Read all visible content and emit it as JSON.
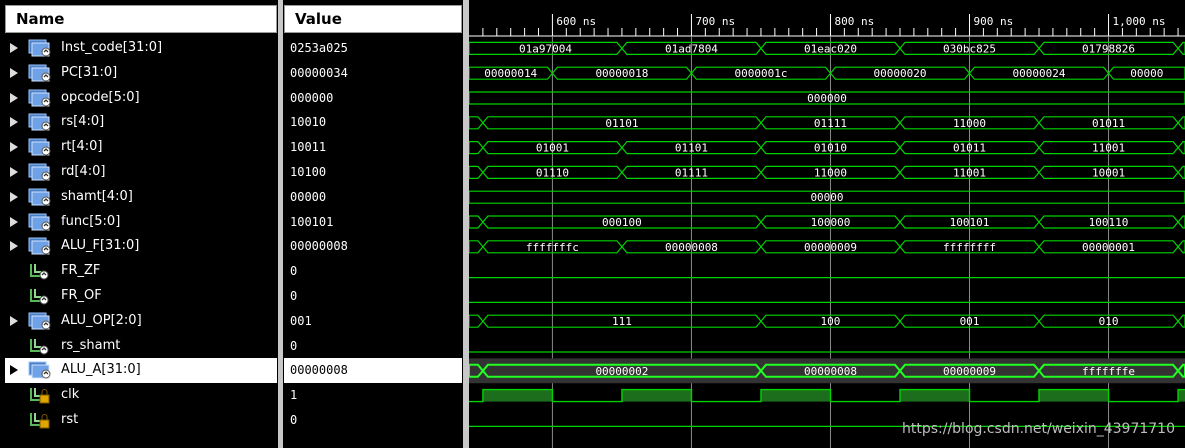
{
  "headers": {
    "name": "Name",
    "value": "Value"
  },
  "signals": [
    {
      "name": "Inst_code[31:0]",
      "value": "0253a025",
      "type": "bus"
    },
    {
      "name": "PC[31:0]",
      "value": "00000034",
      "type": "bus"
    },
    {
      "name": "opcode[5:0]",
      "value": "000000",
      "type": "bus"
    },
    {
      "name": "rs[4:0]",
      "value": "10010",
      "type": "bus"
    },
    {
      "name": "rt[4:0]",
      "value": "10011",
      "type": "bus"
    },
    {
      "name": "rd[4:0]",
      "value": "10100",
      "type": "bus"
    },
    {
      "name": "shamt[4:0]",
      "value": "00000",
      "type": "bus"
    },
    {
      "name": "func[5:0]",
      "value": "100101",
      "type": "bus"
    },
    {
      "name": "ALU_F[31:0]",
      "value": "00000008",
      "type": "bus"
    },
    {
      "name": "FR_ZF",
      "value": "0",
      "type": "bit"
    },
    {
      "name": "FR_OF",
      "value": "0",
      "type": "bit"
    },
    {
      "name": "ALU_OP[2:0]",
      "value": "001",
      "type": "bus"
    },
    {
      "name": "rs_shamt",
      "value": "0",
      "type": "bit"
    },
    {
      "name": "ALU_A[31:0]",
      "value": "00000008",
      "type": "bus",
      "selected": true
    },
    {
      "name": "clk",
      "value": "1",
      "type": "bit-locked"
    },
    {
      "name": "rst",
      "value": "0",
      "type": "bit-locked"
    }
  ],
  "timeline": {
    "ticks": [
      "600 ns",
      "700 ns",
      "800 ns",
      "900 ns",
      "1,000 ns"
    ],
    "tick_times_ns": [
      600,
      700,
      800,
      900,
      1000
    ],
    "view_start_ns": 540,
    "view_end_ns": 1055
  },
  "waves": [
    {
      "kind": "bus",
      "segments": [
        {
          "start": 540,
          "end": 650,
          "label": "01a97004"
        },
        {
          "start": 650,
          "end": 750,
          "label": "01ad7804"
        },
        {
          "start": 750,
          "end": 850,
          "label": "01eac020"
        },
        {
          "start": 850,
          "end": 950,
          "label": "030bc825"
        },
        {
          "start": 950,
          "end": 1050,
          "label": "01798826"
        },
        {
          "start": 1050,
          "end": 1055,
          "label": ""
        }
      ]
    },
    {
      "kind": "bus",
      "segments": [
        {
          "start": 540,
          "end": 600,
          "label": "00000014"
        },
        {
          "start": 600,
          "end": 700,
          "label": "00000018"
        },
        {
          "start": 700,
          "end": 800,
          "label": "0000001c"
        },
        {
          "start": 800,
          "end": 900,
          "label": "00000020"
        },
        {
          "start": 900,
          "end": 1000,
          "label": "00000024"
        },
        {
          "start": 1000,
          "end": 1055,
          "label": "00000"
        }
      ]
    },
    {
      "kind": "bus",
      "segments": [
        {
          "start": 540,
          "end": 1055,
          "label": "000000"
        }
      ]
    },
    {
      "kind": "bus",
      "segments": [
        {
          "start": 540,
          "end": 550,
          "label": ""
        },
        {
          "start": 550,
          "end": 750,
          "label": "01101"
        },
        {
          "start": 750,
          "end": 850,
          "label": "01111"
        },
        {
          "start": 850,
          "end": 950,
          "label": "11000"
        },
        {
          "start": 950,
          "end": 1050,
          "label": "01011"
        },
        {
          "start": 1050,
          "end": 1055,
          "label": ""
        }
      ]
    },
    {
      "kind": "bus",
      "segments": [
        {
          "start": 540,
          "end": 550,
          "label": ""
        },
        {
          "start": 550,
          "end": 650,
          "label": "01001"
        },
        {
          "start": 650,
          "end": 750,
          "label": "01101"
        },
        {
          "start": 750,
          "end": 850,
          "label": "01010"
        },
        {
          "start": 850,
          "end": 950,
          "label": "01011"
        },
        {
          "start": 950,
          "end": 1050,
          "label": "11001"
        },
        {
          "start": 1050,
          "end": 1055,
          "label": ""
        }
      ]
    },
    {
      "kind": "bus",
      "segments": [
        {
          "start": 540,
          "end": 550,
          "label": ""
        },
        {
          "start": 550,
          "end": 650,
          "label": "01110"
        },
        {
          "start": 650,
          "end": 750,
          "label": "01111"
        },
        {
          "start": 750,
          "end": 850,
          "label": "11000"
        },
        {
          "start": 850,
          "end": 950,
          "label": "11001"
        },
        {
          "start": 950,
          "end": 1050,
          "label": "10001"
        },
        {
          "start": 1050,
          "end": 1055,
          "label": ""
        }
      ]
    },
    {
      "kind": "bus",
      "segments": [
        {
          "start": 540,
          "end": 1055,
          "label": "00000"
        }
      ]
    },
    {
      "kind": "bus",
      "segments": [
        {
          "start": 540,
          "end": 550,
          "label": ""
        },
        {
          "start": 550,
          "end": 750,
          "label": "000100"
        },
        {
          "start": 750,
          "end": 850,
          "label": "100000"
        },
        {
          "start": 850,
          "end": 950,
          "label": "100101"
        },
        {
          "start": 950,
          "end": 1050,
          "label": "100110"
        },
        {
          "start": 1050,
          "end": 1055,
          "label": ""
        }
      ]
    },
    {
      "kind": "bus",
      "segments": [
        {
          "start": 540,
          "end": 550,
          "label": ""
        },
        {
          "start": 550,
          "end": 650,
          "label": "fffffffc"
        },
        {
          "start": 650,
          "end": 750,
          "label": "00000008"
        },
        {
          "start": 750,
          "end": 850,
          "label": "00000009"
        },
        {
          "start": 850,
          "end": 950,
          "label": "ffffffff"
        },
        {
          "start": 950,
          "end": 1050,
          "label": "00000001"
        },
        {
          "start": 1050,
          "end": 1055,
          "label": ""
        }
      ]
    },
    {
      "kind": "bit",
      "level": 0
    },
    {
      "kind": "bit",
      "level": 0
    },
    {
      "kind": "bus",
      "segments": [
        {
          "start": 540,
          "end": 550,
          "label": ""
        },
        {
          "start": 550,
          "end": 750,
          "label": "111"
        },
        {
          "start": 750,
          "end": 850,
          "label": "100"
        },
        {
          "start": 850,
          "end": 950,
          "label": "001"
        },
        {
          "start": 950,
          "end": 1050,
          "label": "010"
        },
        {
          "start": 1050,
          "end": 1055,
          "label": ""
        }
      ]
    },
    {
      "kind": "bit",
      "level": 0
    },
    {
      "kind": "bus",
      "bold": true,
      "segments": [
        {
          "start": 540,
          "end": 550,
          "label": ""
        },
        {
          "start": 550,
          "end": 750,
          "label": "00000002"
        },
        {
          "start": 750,
          "end": 850,
          "label": "00000008"
        },
        {
          "start": 850,
          "end": 950,
          "label": "00000009"
        },
        {
          "start": 950,
          "end": 1050,
          "label": "fffffffe"
        },
        {
          "start": 1050,
          "end": 1055,
          "label": ""
        }
      ]
    },
    {
      "kind": "clock",
      "period_ns": 100,
      "high_first_ns": 550
    },
    {
      "kind": "bit",
      "level": 0
    }
  ],
  "watermark": "https://blog.csdn.net/weixin_43971710",
  "colors": {
    "wave": "#00d400",
    "wave_bold": "#22ff22",
    "clock_fill": "#1c6e1c",
    "cursor": "#e8e8e8"
  }
}
